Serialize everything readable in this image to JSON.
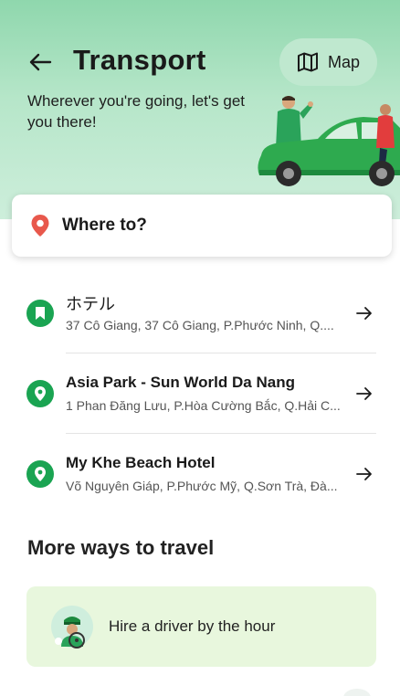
{
  "header": {
    "title": "Transport",
    "subtitle": "Wherever you're going, let's get you there!",
    "map_label": "Map"
  },
  "search": {
    "label": "Where to?"
  },
  "places": [
    {
      "name": "ホテル",
      "address": "37 Cô Giang, 37 Cô Giang, P.Phước Ninh, Q....",
      "icon": "bookmark-icon"
    },
    {
      "name": "Asia Park - Sun World Da Nang",
      "address": "1 Phan Đăng Lưu, P.Hòa Cường Bắc, Q.Hải C...",
      "icon": "location-pin-icon"
    },
    {
      "name": "My Khe Beach Hotel",
      "address": "Võ Nguyên Giáp, P.Phước Mỹ, Q.Sơn Trà, Đà...",
      "icon": "location-pin-icon"
    }
  ],
  "more": {
    "title": "More ways to travel",
    "hire_label": "Hire a driver by the hour"
  },
  "colors": {
    "brand_green": "#1aa452",
    "header_bg": "#b6e6c9",
    "pin_red": "#e8584c",
    "card_bg": "#e8f7dd"
  }
}
